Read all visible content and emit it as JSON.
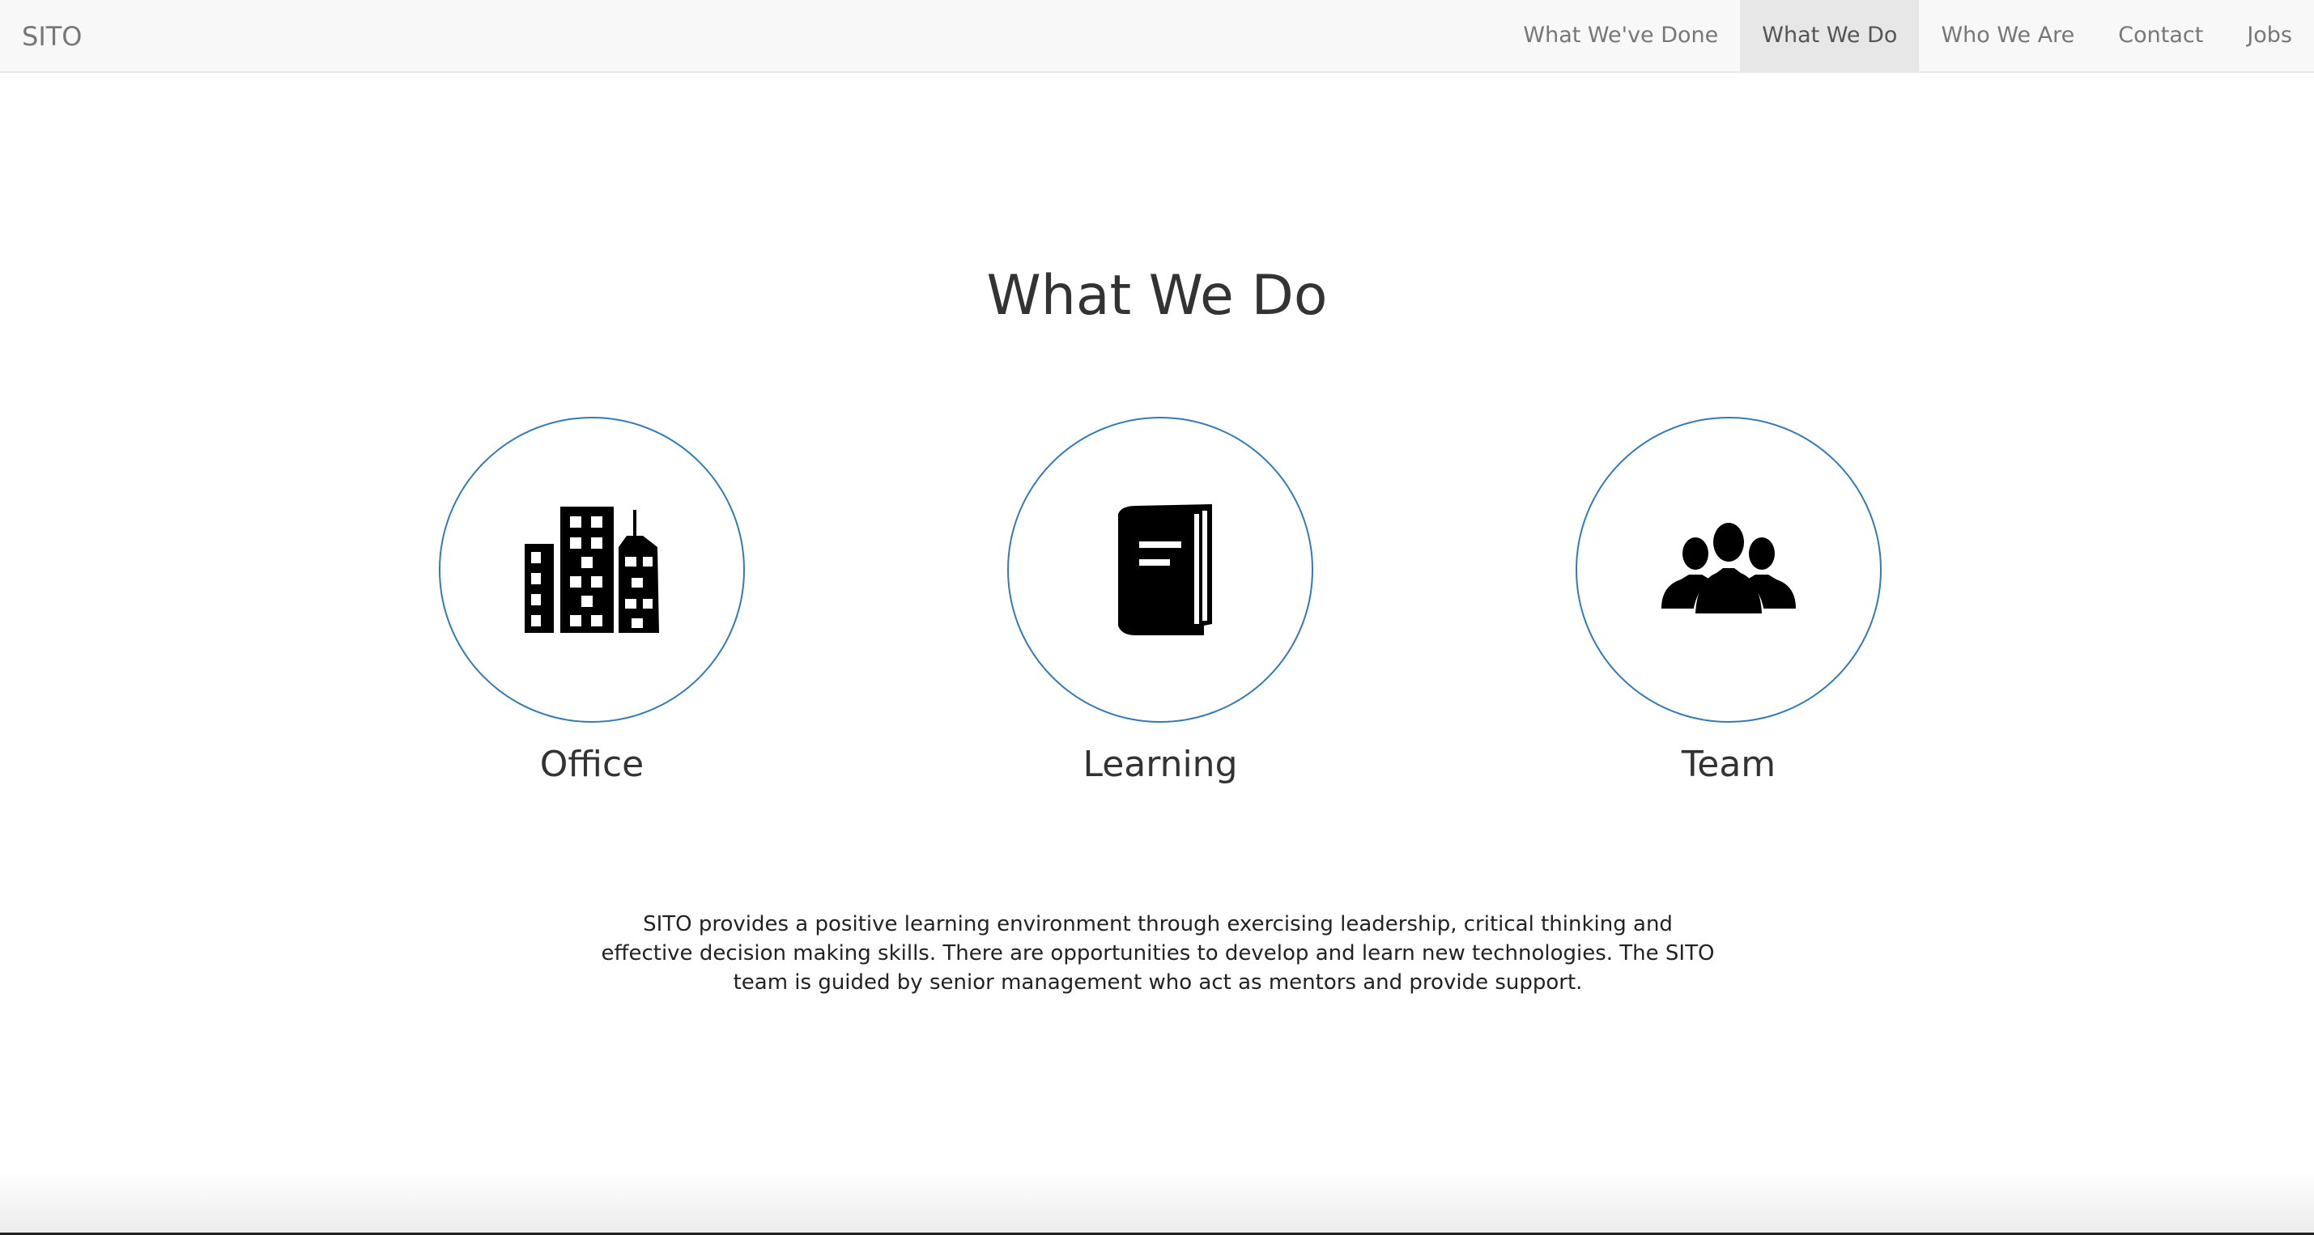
{
  "navbar": {
    "brand": "SITO",
    "links": [
      {
        "label": "What We've Done",
        "active": false
      },
      {
        "label": "What We Do",
        "active": true
      },
      {
        "label": "Who We Are",
        "active": false
      },
      {
        "label": "Contact",
        "active": false
      },
      {
        "label": "Jobs",
        "active": false
      }
    ]
  },
  "section": {
    "title": "What We Do",
    "features": [
      {
        "label": "Office",
        "icon": "office-buildings-icon"
      },
      {
        "label": "Learning",
        "icon": "book-icon"
      },
      {
        "label": "Team",
        "icon": "team-icon"
      }
    ],
    "description": "SITO provides a positive learning environment through exercising leadership, critical thinking and effective decision making skills. There are opportunities to develop and learn new technologies. The SITO team is guided by senior management who act as mentors and provide support."
  },
  "colors": {
    "accent": "#337ab7",
    "navbar_bg": "#f8f8f8",
    "active_nav_bg": "#e7e7e7",
    "text": "#333333"
  }
}
